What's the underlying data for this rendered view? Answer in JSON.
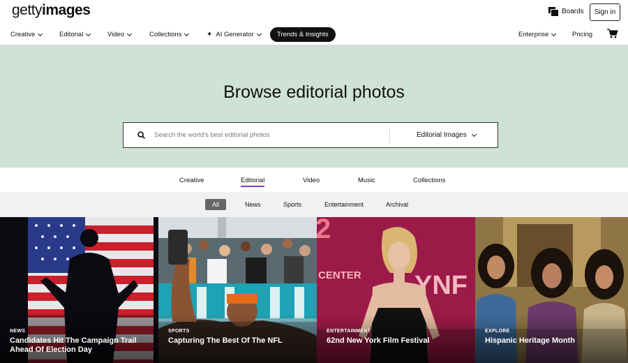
{
  "header": {
    "logo_light": "getty",
    "logo_bold": "images",
    "boards_label": "Boards",
    "signin_label": "Sign in"
  },
  "nav": {
    "items": [
      {
        "label": "Creative"
      },
      {
        "label": "Editorial"
      },
      {
        "label": "Video"
      },
      {
        "label": "Collections"
      },
      {
        "label": "AI Generator"
      }
    ],
    "trends_label": "Trends & Insights",
    "enterprise_label": "Enterprise",
    "pricing_label": "Pricing"
  },
  "hero": {
    "title": "Browse editorial photos",
    "search_placeholder": "Search the world's best editorial photos",
    "search_type": "Editorial Images"
  },
  "tabs": {
    "items": [
      "Creative",
      "Editorial",
      "Video",
      "Music",
      "Collections"
    ],
    "active": "Editorial"
  },
  "filters": {
    "items": [
      "All",
      "News",
      "Sports",
      "Entertainment",
      "Archival"
    ],
    "active": "All"
  },
  "tiles": [
    {
      "category": "NEWS",
      "title": "Candidates Hit The Campaign Trail Ahead Of Election Day"
    },
    {
      "category": "SPORTS",
      "title": "Capturing The Best Of The NFL"
    },
    {
      "category": "ENTERTAINMENT",
      "title": "62nd New York Film Festival"
    },
    {
      "category": "EXPLORE",
      "title": "Hispanic Heritage Month"
    }
  ],
  "colors": {
    "hero_bg": "#cfe2d6",
    "active_tab_underline": "#7b3fc9",
    "trends_bg": "#111111"
  }
}
